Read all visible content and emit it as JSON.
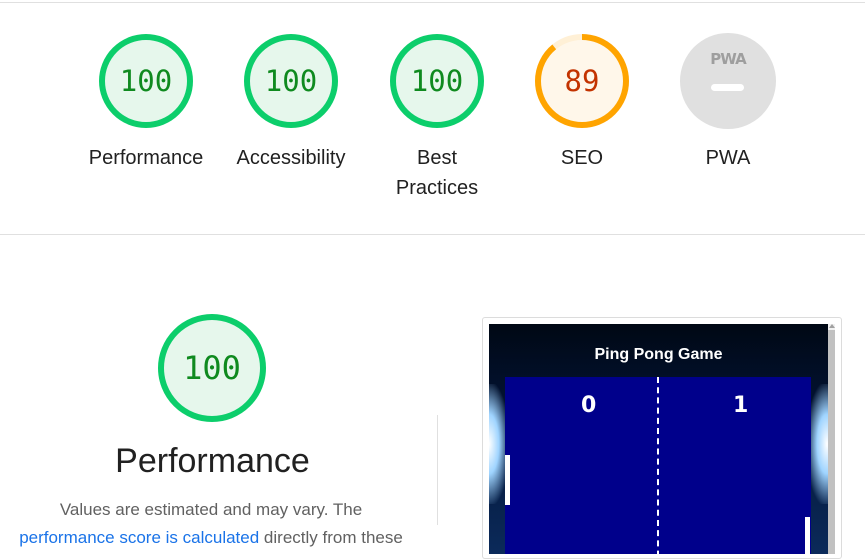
{
  "summary": {
    "categories": [
      {
        "score": "100",
        "label": "Performance",
        "color": "#0cce6b",
        "fill": "#e6f7ec",
        "text_color": "#0f8a1f"
      },
      {
        "score": "100",
        "label": "Accessibility",
        "color": "#0cce6b",
        "fill": "#e6f7ec",
        "text_color": "#0f8a1f"
      },
      {
        "score": "100",
        "label": "Best Practices",
        "color": "#0cce6b",
        "fill": "#e6f7ec",
        "text_color": "#0f8a1f"
      },
      {
        "score": "89",
        "label": "SEO",
        "color": "#ffa400",
        "fill": "#fff7ea",
        "text_color": "#c33300"
      },
      {
        "score": "",
        "label": "PWA",
        "badge_text": "PWA"
      }
    ]
  },
  "performance": {
    "score": "100",
    "title": "Performance",
    "description_prefix": "Values are estimated and may vary. The",
    "link_text": "performance score is calculated",
    "description_suffix": " directly from these"
  },
  "screenshot": {
    "game_title": "Ping Pong Game",
    "score_left": "0",
    "score_right": "1"
  }
}
